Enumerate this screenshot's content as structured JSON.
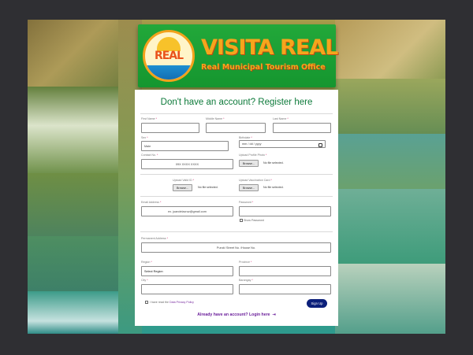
{
  "brand": {
    "logo_text": "REAL",
    "title": "VISITA REAL",
    "subtitle": "Real Municipal Tourism Office"
  },
  "form": {
    "heading": "Don't have an account? Register here",
    "first_name": {
      "label": "First Name",
      "value": ""
    },
    "middle_name": {
      "label": "Middle Name",
      "value": ""
    },
    "last_name": {
      "label": "Last Name",
      "value": ""
    },
    "sex": {
      "label": "Sex",
      "value": "Male"
    },
    "birthdate": {
      "label": "Birthdate",
      "value": "mm / dd / yyyy"
    },
    "contact_no": {
      "label": "Contact No.",
      "placeholder": "09X XXXX XXXX"
    },
    "profile_photo": {
      "label": "Upload Profile Photo",
      "button": "Browse...",
      "note": "No file selected."
    },
    "valid_id": {
      "label": "Upload Valid ID",
      "button": "Browse...",
      "note": "No file selected."
    },
    "vaccination_card": {
      "label": "Upload Vaccination Card",
      "button": "Browse...",
      "note": "No file selected."
    },
    "email": {
      "label": "Email Address",
      "placeholder": "ex. juandelacruz@gmail.com"
    },
    "password": {
      "label": "Password",
      "value": ""
    },
    "show_password": "Show Password",
    "permanent_address": {
      "label": "Permanent Address",
      "placeholder": "Purok/ Street No. /House No."
    },
    "region": {
      "label": "Region",
      "value": "Select Region"
    },
    "province": {
      "label": "Province",
      "value": ""
    },
    "city": {
      "label": "City",
      "value": ""
    },
    "barangay": {
      "label": "Barangay",
      "value": ""
    },
    "agree_text": "I have read the ",
    "agree_link": "Data Privacy Policy",
    "signup_button": "Sign Up",
    "login_link": "Already have an account? Login here"
  },
  "colors": {
    "banner": "#1aa035",
    "title_orange": "#f6a51c",
    "heading_green": "#0d7a3a",
    "signup_navy": "#0b1f7a",
    "login_purple": "#6b1f9b"
  }
}
